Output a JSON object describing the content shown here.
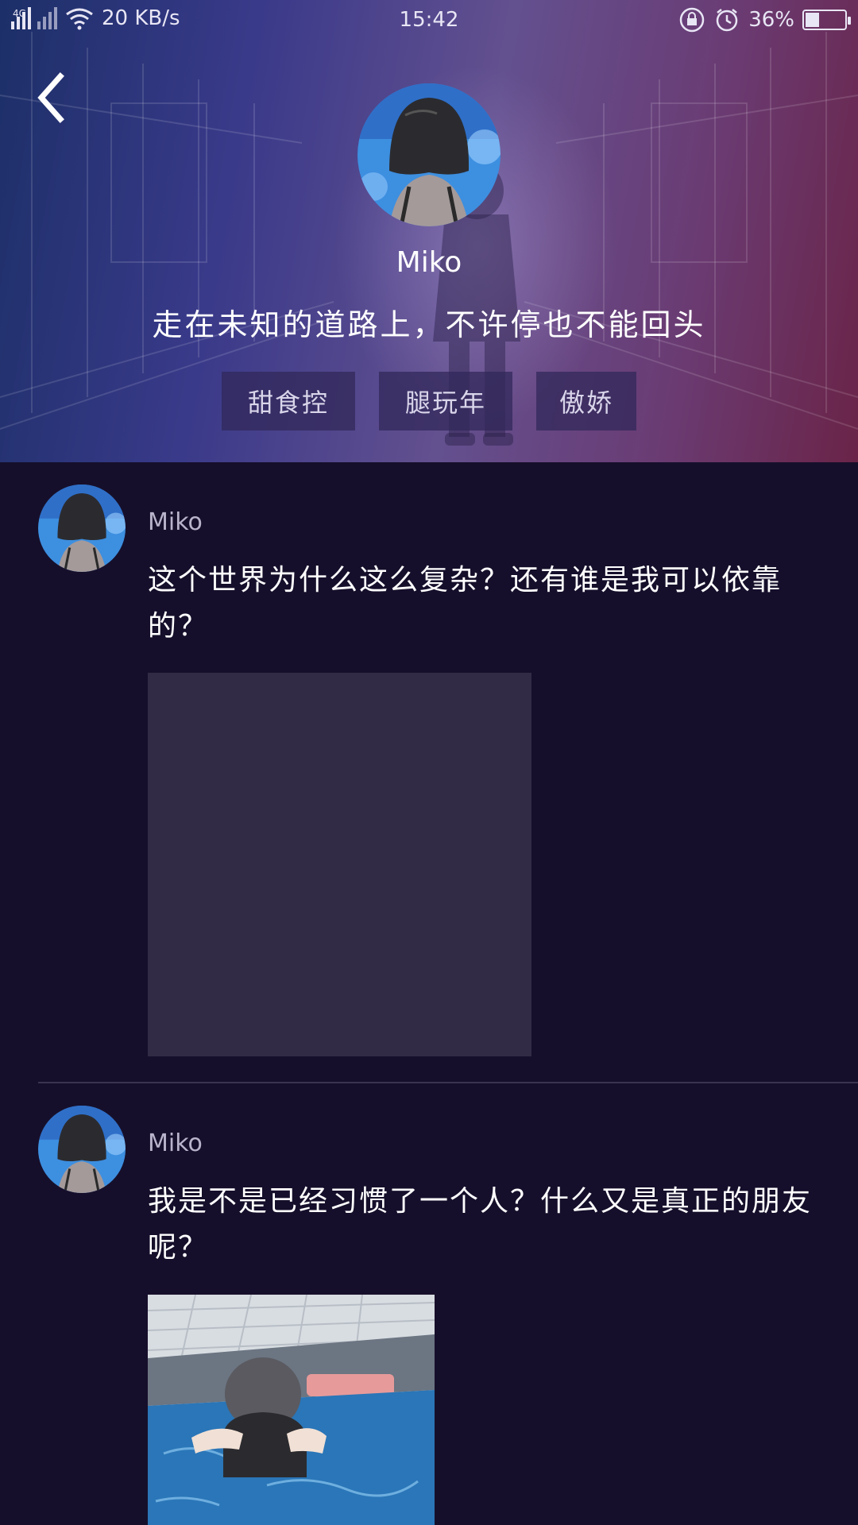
{
  "status_bar": {
    "network": "4G",
    "speed": "20 KB/s",
    "time": "15:42",
    "battery_percent": "36%",
    "battery_level": 0.36
  },
  "profile": {
    "name": "Miko",
    "motto": "走在未知的道路上，不许停也不能回头",
    "tags": [
      "甜食控",
      "腿玩年",
      "傲娇"
    ]
  },
  "posts": [
    {
      "author": "Miko",
      "text": "这个世界为什么这么复杂？还有谁是我可以依靠的？"
    },
    {
      "author": "Miko",
      "text": "我是不是已经习惯了一个人？什么又是真正的朋友呢？"
    }
  ],
  "colors": {
    "background": "#160f2b",
    "image_placeholder": "#312b45",
    "tag_bg": "#32285a"
  }
}
